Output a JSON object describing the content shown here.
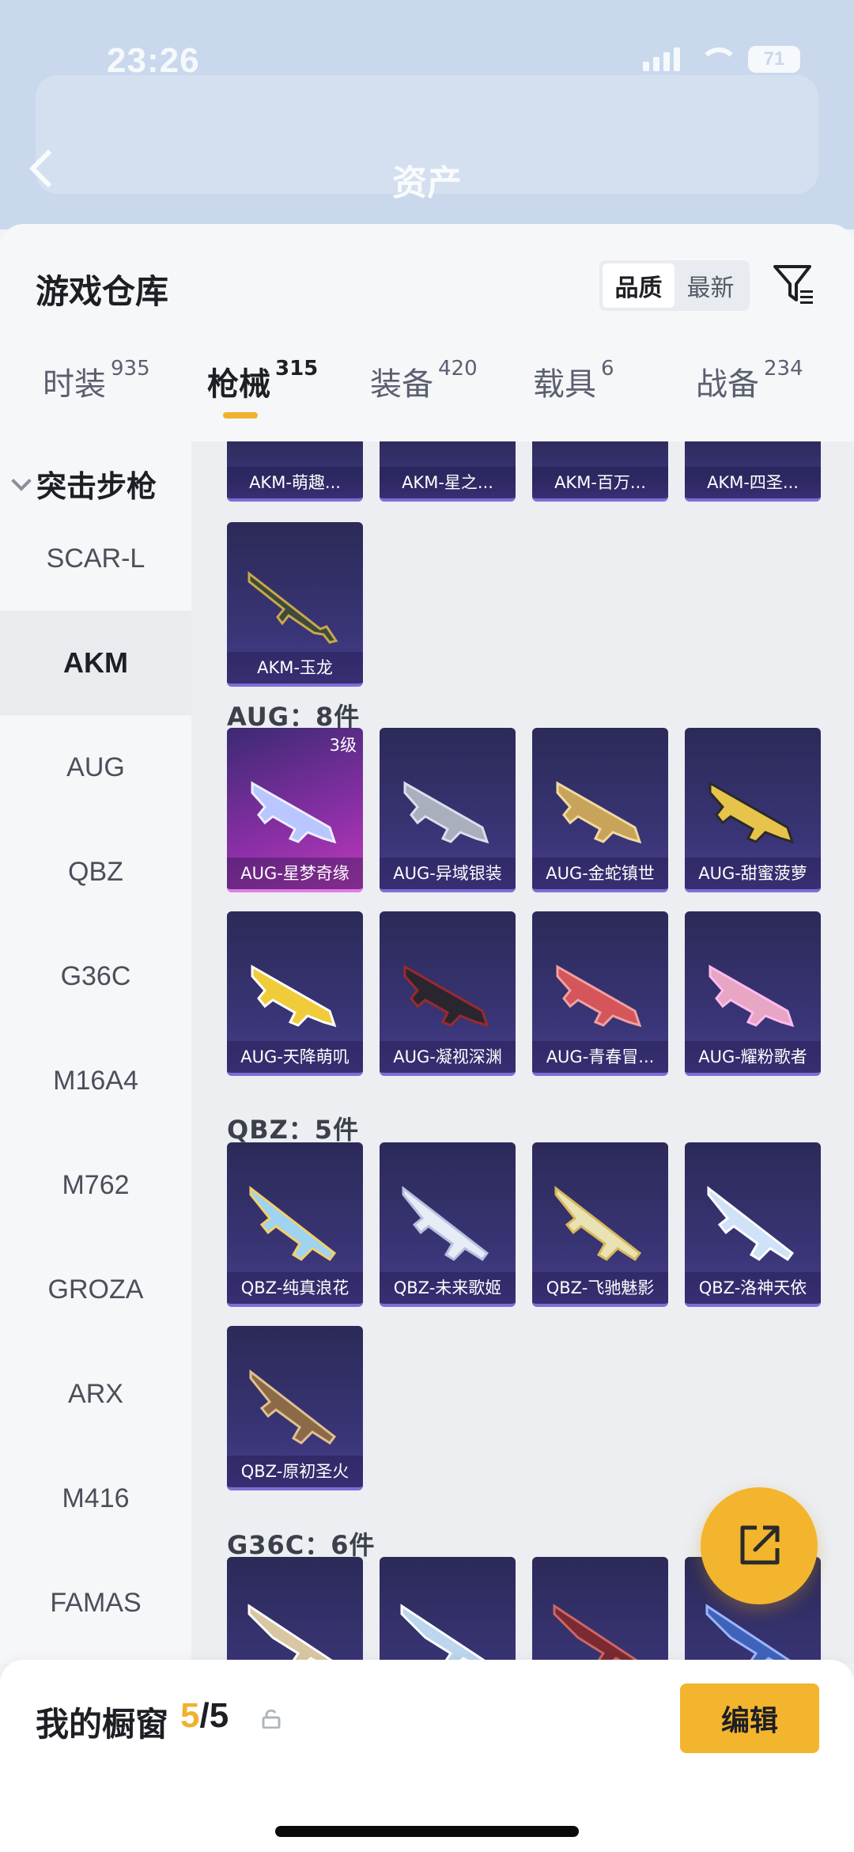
{
  "status_bar": {
    "time": "23:26",
    "battery": "71"
  },
  "header": {
    "title": "资产"
  },
  "sheet": {
    "title": "游戏仓库",
    "sort_options": [
      "品质",
      "最新"
    ],
    "sort_selected": "品质"
  },
  "tabs": [
    {
      "label": "时装",
      "count": "935"
    },
    {
      "label": "枪械",
      "count": "315",
      "active": true
    },
    {
      "label": "装备",
      "count": "420"
    },
    {
      "label": "载具",
      "count": "6"
    },
    {
      "label": "战备",
      "count": "234"
    }
  ],
  "sidenav": {
    "group": "突击步枪",
    "items": [
      "SCAR-L",
      "AKM",
      "AUG",
      "QBZ",
      "G36C",
      "M16A4",
      "M762",
      "GROZA",
      "ARX",
      "M416",
      "FAMAS"
    ],
    "selected": "AKM"
  },
  "sections": {
    "akm_top": [
      "AKM-萌趣...",
      "AKM-星之...",
      "AKM-百万...",
      "AKM-四圣..."
    ],
    "akm_row": [
      "AKM-玉龙"
    ],
    "aug": {
      "title": "AUG：8件",
      "items": [
        "AUG-星梦奇缘",
        "AUG-异域银装",
        "AUG-金蛇镇世",
        "AUG-甜蜜菠萝",
        "AUG-天降萌叽",
        "AUG-凝视深渊",
        "AUG-青春冒...",
        "AUG-耀粉歌者"
      ],
      "tier": "3级"
    },
    "qbz": {
      "title": "QBZ：5件",
      "items": [
        "QBZ-纯真浪花",
        "QBZ-未来歌姬",
        "QBZ-飞驰魅影",
        "QBZ-洛神天依",
        "QBZ-原初圣火"
      ]
    },
    "g36c": {
      "title": "G36C：6件"
    }
  },
  "bottom": {
    "label": "我的橱窗",
    "current": "5",
    "total": "/5",
    "edit": "编辑"
  },
  "colors": {
    "accent": "#f3b52e",
    "card_dark": "#2b2a58",
    "card_pink": "#c03ab8"
  },
  "icons": [
    "back-icon",
    "filter-icon",
    "share-icon",
    "lock-icon",
    "chevron-down-icon"
  ]
}
